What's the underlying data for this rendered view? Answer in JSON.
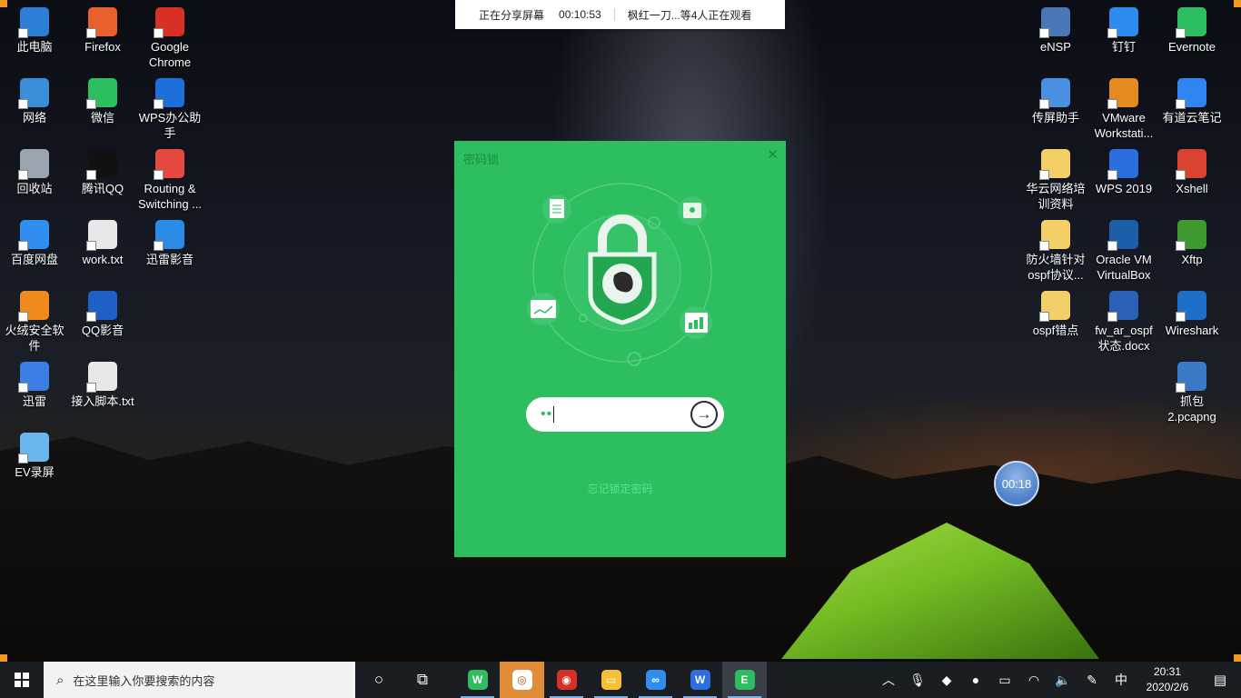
{
  "share_banner": {
    "status": "正在分享屏幕",
    "elapsed": "00:10:53",
    "viewers": "枫红一刀...等4人正在观看"
  },
  "desktop_icons_left": [
    {
      "label": "此电脑",
      "icon": "this-pc-icon",
      "color": "#2b7fd6"
    },
    {
      "label": "Firefox",
      "icon": "firefox-icon",
      "color": "#e8602c"
    },
    {
      "label": "Google Chrome",
      "icon": "chrome-icon",
      "color": "#d93025"
    },
    {
      "label": "网络",
      "icon": "network-icon",
      "color": "#3a8fd8"
    },
    {
      "label": "微信",
      "icon": "wechat-icon",
      "color": "#2dbe60"
    },
    {
      "label": "WPS办公助手",
      "icon": "wps-assistant-icon",
      "color": "#1e6fd9"
    },
    {
      "label": "回收站",
      "icon": "recycle-bin-icon",
      "color": "#9aa5b1"
    },
    {
      "label": "腾讯QQ",
      "icon": "qq-icon",
      "color": "#111111"
    },
    {
      "label": "Routing & Switching ...",
      "icon": "pdf-icon",
      "color": "#e5483e"
    },
    {
      "label": "百度网盘",
      "icon": "baidu-netdisk-icon",
      "color": "#2f8ef0"
    },
    {
      "label": "work.txt",
      "icon": "text-file-icon",
      "color": "#e8e8e8"
    },
    {
      "label": "迅雷影音",
      "icon": "xunlei-player-icon",
      "color": "#2a8ae8"
    },
    {
      "label": "火绒安全软件",
      "icon": "huorong-icon",
      "color": "#f08a1c"
    },
    {
      "label": "QQ影音",
      "icon": "qq-player-icon",
      "color": "#1e5fc8"
    },
    {
      "label": "迅雷",
      "icon": "xunlei-icon",
      "color": "#3a7ee6"
    },
    {
      "label": "接入脚本.txt",
      "icon": "text-file-icon",
      "color": "#e8e8e8"
    },
    {
      "label": "EV录屏",
      "icon": "ev-recorder-icon",
      "color": "#6ab7f0"
    }
  ],
  "desktop_icons_right": [
    {
      "label": "eNSP",
      "icon": "ensp-icon",
      "color": "#4a77b8"
    },
    {
      "label": "钉钉",
      "icon": "dingtalk-icon",
      "color": "#2d8cf0"
    },
    {
      "label": "Evernote",
      "icon": "evernote-icon",
      "color": "#2dbe60"
    },
    {
      "label": "传屏助手",
      "icon": "cast-screen-icon",
      "color": "#4a8fe0"
    },
    {
      "label": "VMware Workstati...",
      "icon": "vmware-icon",
      "color": "#e58a1f"
    },
    {
      "label": "有道云笔记",
      "icon": "youdao-note-icon",
      "color": "#2f86f0"
    },
    {
      "label": "华云网络培训资料",
      "icon": "folder-zip-icon",
      "color": "#f3cf68"
    },
    {
      "label": "WPS 2019",
      "icon": "wps-icon",
      "color": "#2a6ee0"
    },
    {
      "label": "Xshell",
      "icon": "xshell-icon",
      "color": "#d9432f"
    },
    {
      "label": "防火墙针对ospf协议...",
      "icon": "folder-zip-icon",
      "color": "#f3cf68"
    },
    {
      "label": "Oracle VM VirtualBox",
      "icon": "virtualbox-icon",
      "color": "#1b5fa8"
    },
    {
      "label": "Xftp",
      "icon": "xftp-icon",
      "color": "#3c9a2e"
    },
    {
      "label": "ospf错点",
      "icon": "folder-zip-icon",
      "color": "#f3cf68"
    },
    {
      "label": "fw_ar_ospf状态.docx",
      "icon": "word-doc-icon",
      "color": "#2b5fb8"
    },
    {
      "label": "Wireshark",
      "icon": "wireshark-icon",
      "color": "#1d6fc9"
    },
    {
      "label": "抓包2.pcapng",
      "icon": "pcap-file-icon",
      "color": "#3a78c8"
    }
  ],
  "dialog": {
    "title": "密码锁",
    "password_mask": "••",
    "forgot_link": "忘记锁定密码",
    "accent": "#2dbe60"
  },
  "timer_bubble": "00:18",
  "taskbar": {
    "search_placeholder": "在这里输入你要搜索的内容",
    "apps": [
      {
        "name": "wechat",
        "icon": "wechat-icon",
        "color": "#2dbe60",
        "glyph": "W"
      },
      {
        "name": "screen-share",
        "icon": "screen-share-icon",
        "color": "#e08b38",
        "glyph": "◎"
      },
      {
        "name": "chrome",
        "icon": "chrome-icon",
        "color": "#d93025",
        "glyph": "◉"
      },
      {
        "name": "file-explorer",
        "icon": "folder-icon",
        "color": "#f3c234",
        "glyph": "▭"
      },
      {
        "name": "baidu-netdisk",
        "icon": "baidu-netdisk-icon",
        "color": "#2f8ef0",
        "glyph": "∞"
      },
      {
        "name": "wps",
        "icon": "wps-icon",
        "color": "#2a6ee0",
        "glyph": "W"
      },
      {
        "name": "evernote",
        "icon": "evernote-icon",
        "color": "#2dbe60",
        "glyph": "E"
      }
    ],
    "tray_ime": "中",
    "time": "20:31",
    "date": "2020/2/6"
  }
}
